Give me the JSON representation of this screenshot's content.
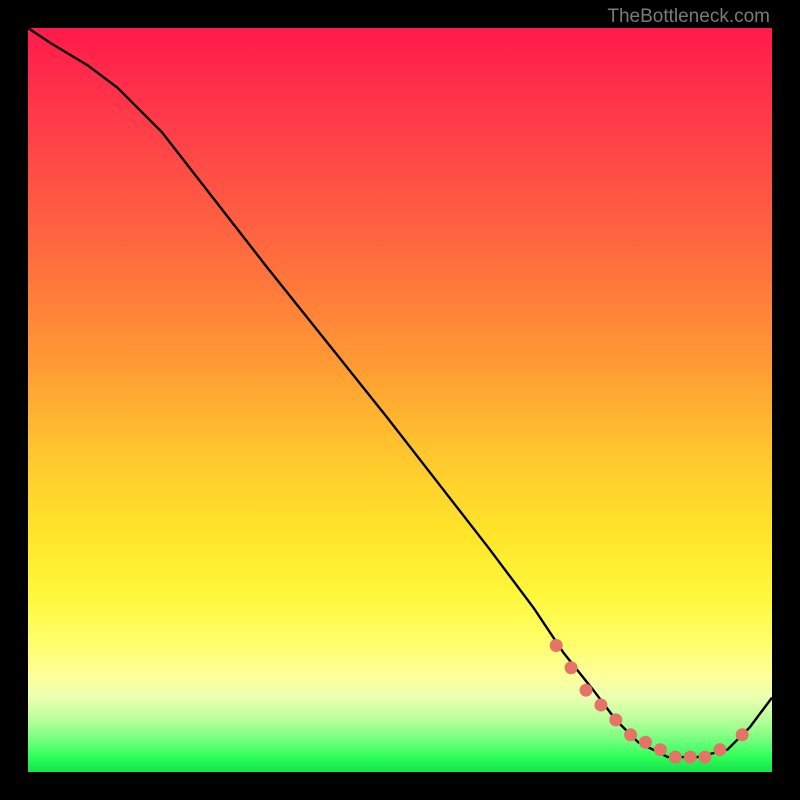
{
  "attribution": "TheBottleneck.com",
  "chart_data": {
    "type": "line",
    "title": "",
    "xlabel": "",
    "ylabel": "",
    "xlim": [
      0,
      100
    ],
    "ylim": [
      0,
      100
    ],
    "series": [
      {
        "name": "curve",
        "x": [
          0,
          3,
          8,
          12,
          18,
          25,
          32,
          40,
          48,
          55,
          62,
          68,
          72,
          76,
          79,
          82,
          86,
          90,
          94,
          97,
          100
        ],
        "values": [
          100,
          98,
          95,
          92,
          86,
          77,
          68,
          58,
          48,
          39,
          30,
          22,
          16,
          11,
          7,
          4,
          2,
          2,
          3,
          6,
          10
        ]
      }
    ],
    "markers": {
      "name": "highlight-segment",
      "color": "#e57366",
      "x": [
        71,
        73,
        75,
        77,
        79,
        81,
        83,
        85,
        87,
        89,
        91,
        93,
        96
      ],
      "values": [
        17,
        14,
        11,
        9,
        7,
        5,
        4,
        3,
        2,
        2,
        2,
        3,
        5
      ]
    },
    "gradient_stops": [
      {
        "pct": 0,
        "color": "#ff1a4b"
      },
      {
        "pct": 30,
        "color": "#ff6a3e"
      },
      {
        "pct": 58,
        "color": "#ffc92d"
      },
      {
        "pct": 82,
        "color": "#ffff66"
      },
      {
        "pct": 93,
        "color": "#b8ff9a"
      },
      {
        "pct": 100,
        "color": "#13e24a"
      }
    ]
  }
}
